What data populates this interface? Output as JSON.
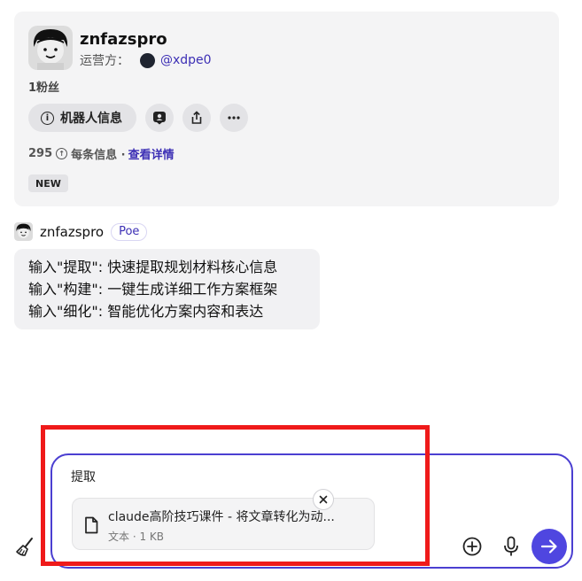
{
  "bot": {
    "name": "znfazspro",
    "operator_label": "运营方：",
    "operator_handle": "@xdpe0",
    "followers": "1粉丝",
    "info_button": "机器人信息",
    "price_value": "295",
    "price_text": "每条信息 ·",
    "details_link": "查看详情",
    "new_badge": "NEW"
  },
  "message": {
    "sender": "znfazspro",
    "tag": "Poe",
    "lines": [
      "输入\"提取\": 快速提取规划材料核心信息",
      "输入\"构建\": 一键生成详细工作方案框架",
      "输入\"细化\": 智能优化方案内容和表达"
    ]
  },
  "composer": {
    "input_text": "提取",
    "attachment": {
      "name": "claude高阶技巧课件 - 将文章转化为动...",
      "meta": "文本 · 1 KB"
    }
  },
  "icons": [
    "avatar",
    "info-icon",
    "chat-user-icon",
    "share-icon",
    "more-icon",
    "coin-icon",
    "file-icon",
    "close-icon",
    "broom-icon",
    "add-icon",
    "mic-icon",
    "send-arrow-icon"
  ],
  "colors": {
    "accent": "#4b3fd1",
    "link": "#3c2fb5",
    "highlight": "#ef1a1a"
  }
}
